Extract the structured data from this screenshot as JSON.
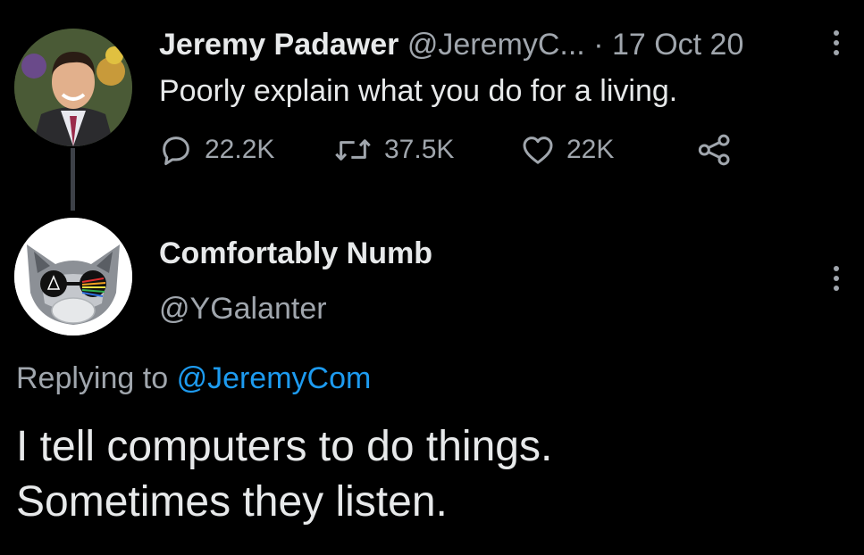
{
  "parent_tweet": {
    "author_name": "Jeremy Padawer",
    "author_handle": "@JeremyC...",
    "date": "· 17 Oct 20",
    "text": "Poorly explain what you do for a living.",
    "stats": {
      "replies": "22.2K",
      "retweets": "37.5K",
      "likes": "22K"
    },
    "icons": {
      "reply": "reply-icon",
      "retweet": "retweet-icon",
      "like": "heart-icon",
      "share": "share-icon",
      "more": "more-vertical-icon"
    }
  },
  "reply_tweet": {
    "author_name": "Comfortably Numb",
    "author_handle": "@YGalanter",
    "replying_to_label": "Replying to",
    "replying_to_handle": "@JeremyCom",
    "text_lines": [
      "I tell computers to do things.",
      "Sometimes they listen."
    ]
  },
  "colors": {
    "background": "#000000",
    "primary_text": "#e7e9ea",
    "secondary_text": "#a0a6ad",
    "link": "#1d9bf0"
  }
}
